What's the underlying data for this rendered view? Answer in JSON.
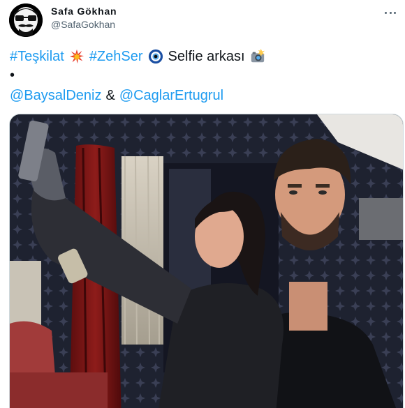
{
  "author": {
    "name": "Safa Gökhan",
    "handle": "@SafaGokhan"
  },
  "tweet": {
    "hashtag_1": "#Teşkilat",
    "hashtag_2": "#ZehSer",
    "text_1": "Selfie arkası",
    "bullet": "•",
    "mention_1": "@BaysalDeniz",
    "ampersand": "&",
    "mention_2": "@CaglarErtugrul"
  },
  "icons": {
    "collision": "collision-icon",
    "nazar": "nazar-amulet-icon",
    "camera": "camera-flash-icon",
    "more": "more-icon"
  },
  "colors": {
    "link": "#1d9bf0",
    "text": "#0f1419",
    "secondary": "#536471"
  }
}
